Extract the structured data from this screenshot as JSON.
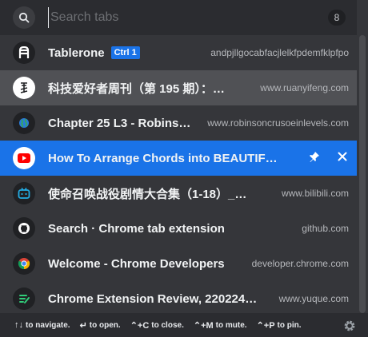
{
  "search": {
    "placeholder": "Search tabs",
    "count": "8"
  },
  "tabs": [
    {
      "title": "Tablerone",
      "badge": "Ctrl 1",
      "url": "andpjllgocabfacjlelkfpdemfklpfpo",
      "icon": "tablerone-icon"
    },
    {
      "title": "科技爱好者周刊（第 195 期）：…",
      "url": "www.ruanyifeng.com",
      "icon": "ruanyifeng-icon"
    },
    {
      "title": "Chapter 25 L3 - Robins…",
      "url": "www.robinsoncrusoeinlevels.com",
      "icon": "globe-icon"
    },
    {
      "title": "How To Arrange Chords into BEAUTIFU…",
      "url": "",
      "icon": "youtube-icon"
    },
    {
      "title": "使命召唤战役剧情大合集（1-18）_…",
      "url": "www.bilibili.com",
      "icon": "bilibili-icon"
    },
    {
      "title": "Search · Chrome tab extension",
      "url": "github.com",
      "icon": "github-icon"
    },
    {
      "title": "Welcome - Chrome Developers",
      "url": "developer.chrome.com",
      "icon": "chrome-icon"
    },
    {
      "title": "Chrome Extension Review, 220224 …",
      "url": "www.yuque.com",
      "icon": "yuque-icon"
    }
  ],
  "footer": {
    "hints": [
      {
        "key": "↑↓",
        "label": "to navigate."
      },
      {
        "key": "↵",
        "label": "to open."
      },
      {
        "key": "⌃+C",
        "label": "to close."
      },
      {
        "key": "⌃+M",
        "label": "to mute."
      },
      {
        "key": "⌃+P",
        "label": "to pin."
      }
    ]
  },
  "colors": {
    "accent": "#1a73e8",
    "background": "#35363a",
    "highlight_row": "#505155"
  }
}
